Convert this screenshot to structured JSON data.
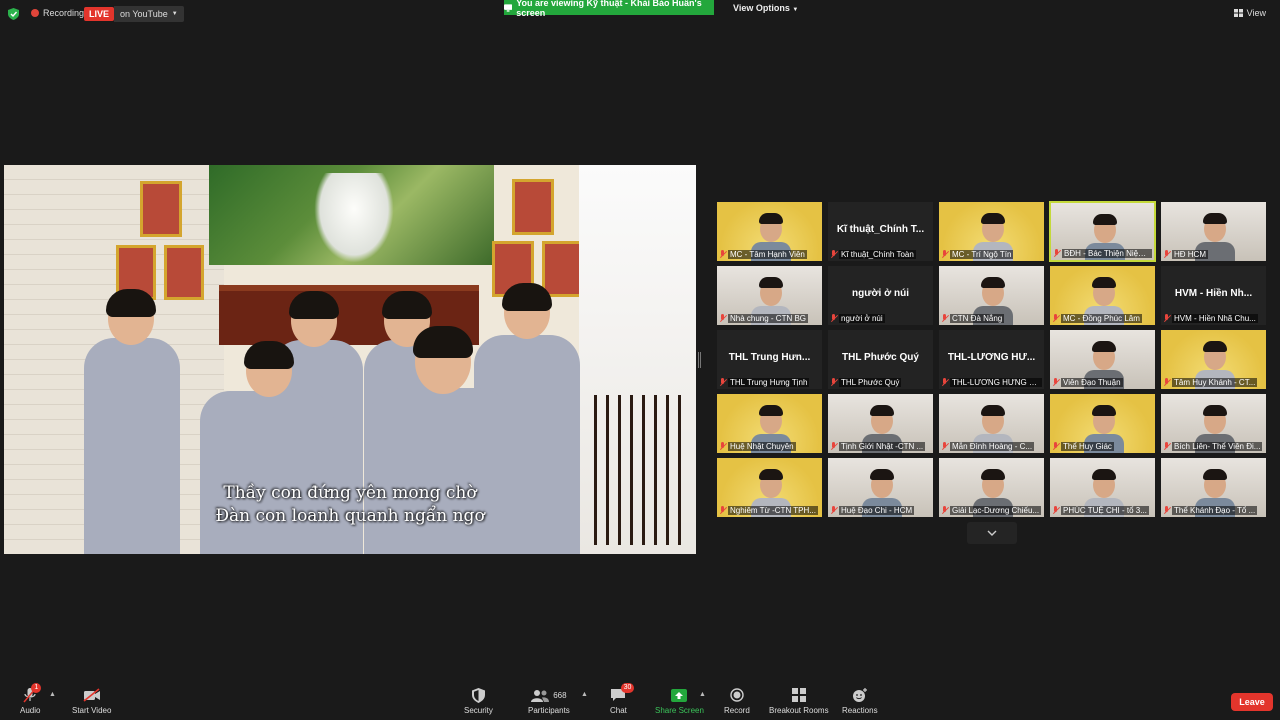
{
  "topbar": {
    "recording_label": "Recording",
    "live_label": "LIVE",
    "live_destination": "on YouTube",
    "viewing_banner": "You are viewing Kỹ thuật - Khải Bảo Huấn's screen",
    "view_options": "View Options",
    "view_label": "View"
  },
  "shared_screen": {
    "subtitle_line1": "Thầy con đứng yên mong chờ",
    "subtitle_line2": "Đàn con loanh quanh ngẩn ngơ"
  },
  "gallery": [
    {
      "name": "MC - Tâm Hạnh Viên",
      "big": "",
      "style": "yellow"
    },
    {
      "name": "Kĩ thuật_Chính Toàn",
      "big": "Kĩ thuật_Chính T...",
      "style": "dark"
    },
    {
      "name": "MC - Trí Ngộ Tín",
      "big": "",
      "style": "yellow"
    },
    {
      "name": "BĐH - Bác Thiện Niệm Chí",
      "big": "",
      "style": "room"
    },
    {
      "name": "HĐ HCM",
      "big": "",
      "style": "room"
    },
    {
      "name": "Nhà chung - CTN BG",
      "big": "",
      "style": "room"
    },
    {
      "name": "người ở núi",
      "big": "người ở núi",
      "style": "dark"
    },
    {
      "name": "CTN Đà Nẵng",
      "big": "",
      "style": "room"
    },
    {
      "name": "MC - Đồng Phúc Lâm",
      "big": "",
      "style": "yellow"
    },
    {
      "name": "HVM - Hiền Nhã Chu...",
      "big": "HVM - Hiền Nh...",
      "style": "dark"
    },
    {
      "name": "THL Trung Hưng Tịnh",
      "big": "THL Trung Hưn...",
      "style": "dark"
    },
    {
      "name": "THL Phước Quý",
      "big": "THL Phước Quý",
      "style": "dark"
    },
    {
      "name": "THL-LƯƠNG HƯNG C...",
      "big": "THL-LƯƠNG HƯ...",
      "style": "dark"
    },
    {
      "name": "Viên Đạo Thuận",
      "big": "",
      "style": "room"
    },
    {
      "name": "Tâm Huy Khánh - CT...",
      "big": "",
      "style": "yellow"
    },
    {
      "name": "Huệ Nhật Chuyên",
      "big": "",
      "style": "yellow"
    },
    {
      "name": "Tịnh Giới Nhật -CTN ...",
      "big": "",
      "style": "room"
    },
    {
      "name": "Mẫn Đình Hoàng - C...",
      "big": "",
      "style": "room"
    },
    {
      "name": "Thể Huy Giác",
      "big": "",
      "style": "yellow"
    },
    {
      "name": "Bích Liên- Thể Viên Đi...",
      "big": "",
      "style": "room"
    },
    {
      "name": "Nghiêm Từ -CTN TPH...",
      "big": "",
      "style": "yellow"
    },
    {
      "name": "Huệ Đạo Chi - HCM",
      "big": "",
      "style": "room"
    },
    {
      "name": "Giải Lạc-Dương Chiếu...",
      "big": "",
      "style": "room"
    },
    {
      "name": "PHÚC TUỆ CHI - tổ 3...",
      "big": "",
      "style": "room"
    },
    {
      "name": "Thể Khánh Đạo - Tổ ...",
      "big": "",
      "style": "room"
    }
  ],
  "toolbar": {
    "audio": "Audio",
    "audio_badge": "1",
    "start_video": "Start Video",
    "security": "Security",
    "participants": "Participants",
    "participants_count": "668",
    "chat": "Chat",
    "chat_badge": "30",
    "share_screen": "Share Screen",
    "record": "Record",
    "breakout_rooms": "Breakout Rooms",
    "reactions": "Reactions",
    "leave": "Leave"
  },
  "colors": {
    "live_red": "#e3352c",
    "viewing_green": "#23a73c",
    "active_speaker": "#c4d93a",
    "share_green": "#23a73c"
  }
}
